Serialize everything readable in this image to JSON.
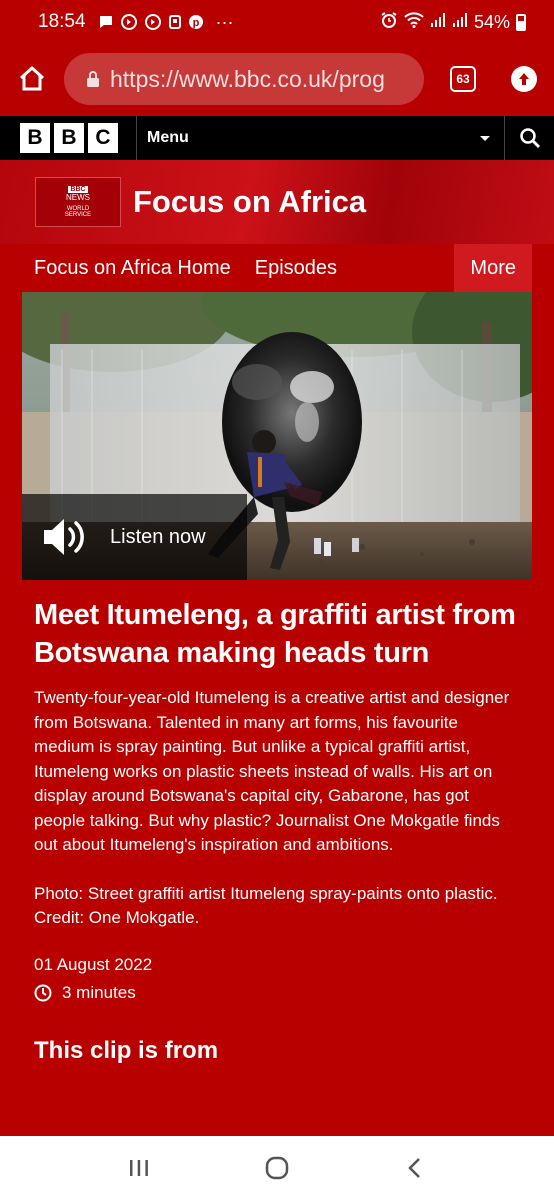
{
  "status_bar": {
    "time": "18:54",
    "battery": "54%",
    "left_icons": [
      "message-icon",
      "whatsapp-icon",
      "whatsapp-icon",
      "notification-icon",
      "pinterest-icon",
      "more-icon"
    ],
    "right_icons": [
      "alarm-icon",
      "wifi-icon",
      "signal-icon",
      "signal-icon",
      "battery-icon"
    ],
    "more_dots": "···"
  },
  "browser": {
    "url": "https://www.bbc.co.uk/prog",
    "tab_count": "63"
  },
  "bbc_header": {
    "logo_letters": [
      "B",
      "B",
      "C"
    ],
    "menu_label": "Menu"
  },
  "masthead": {
    "logo_lines": [
      "BBC",
      "NEWS",
      "WORLD",
      "SERVICE"
    ],
    "title": "Focus on Africa"
  },
  "program_nav": {
    "links": [
      "Focus on Africa Home",
      "Episodes"
    ],
    "more": "More"
  },
  "clip": {
    "listen_label": "Listen now",
    "headline": "Meet Itumeleng, a graffiti artist from Botswana making heads turn",
    "description": "Twenty-four-year-old Itumeleng is a creative artist and designer from Botswana. Talented in many art forms, his favourite medium is spray painting. But unlike a typical graffiti artist, Itumeleng works on plastic sheets instead of walls. His art on display around Botswana's capital city, Gabarone, has got people talking. But why plastic? Journalist One Mokgatle finds out about Itumeleng's inspiration and ambitions.",
    "caption": "Photo: Street graffiti artist Itumeleng spray-paints onto plastic. Credit: One Mokgatle.",
    "date": "01 August 2022",
    "duration": "3 minutes",
    "clip_from_heading": "This clip is from"
  },
  "colors": {
    "bbc_red": "#b80000",
    "black": "#000000",
    "white": "#ffffff"
  }
}
